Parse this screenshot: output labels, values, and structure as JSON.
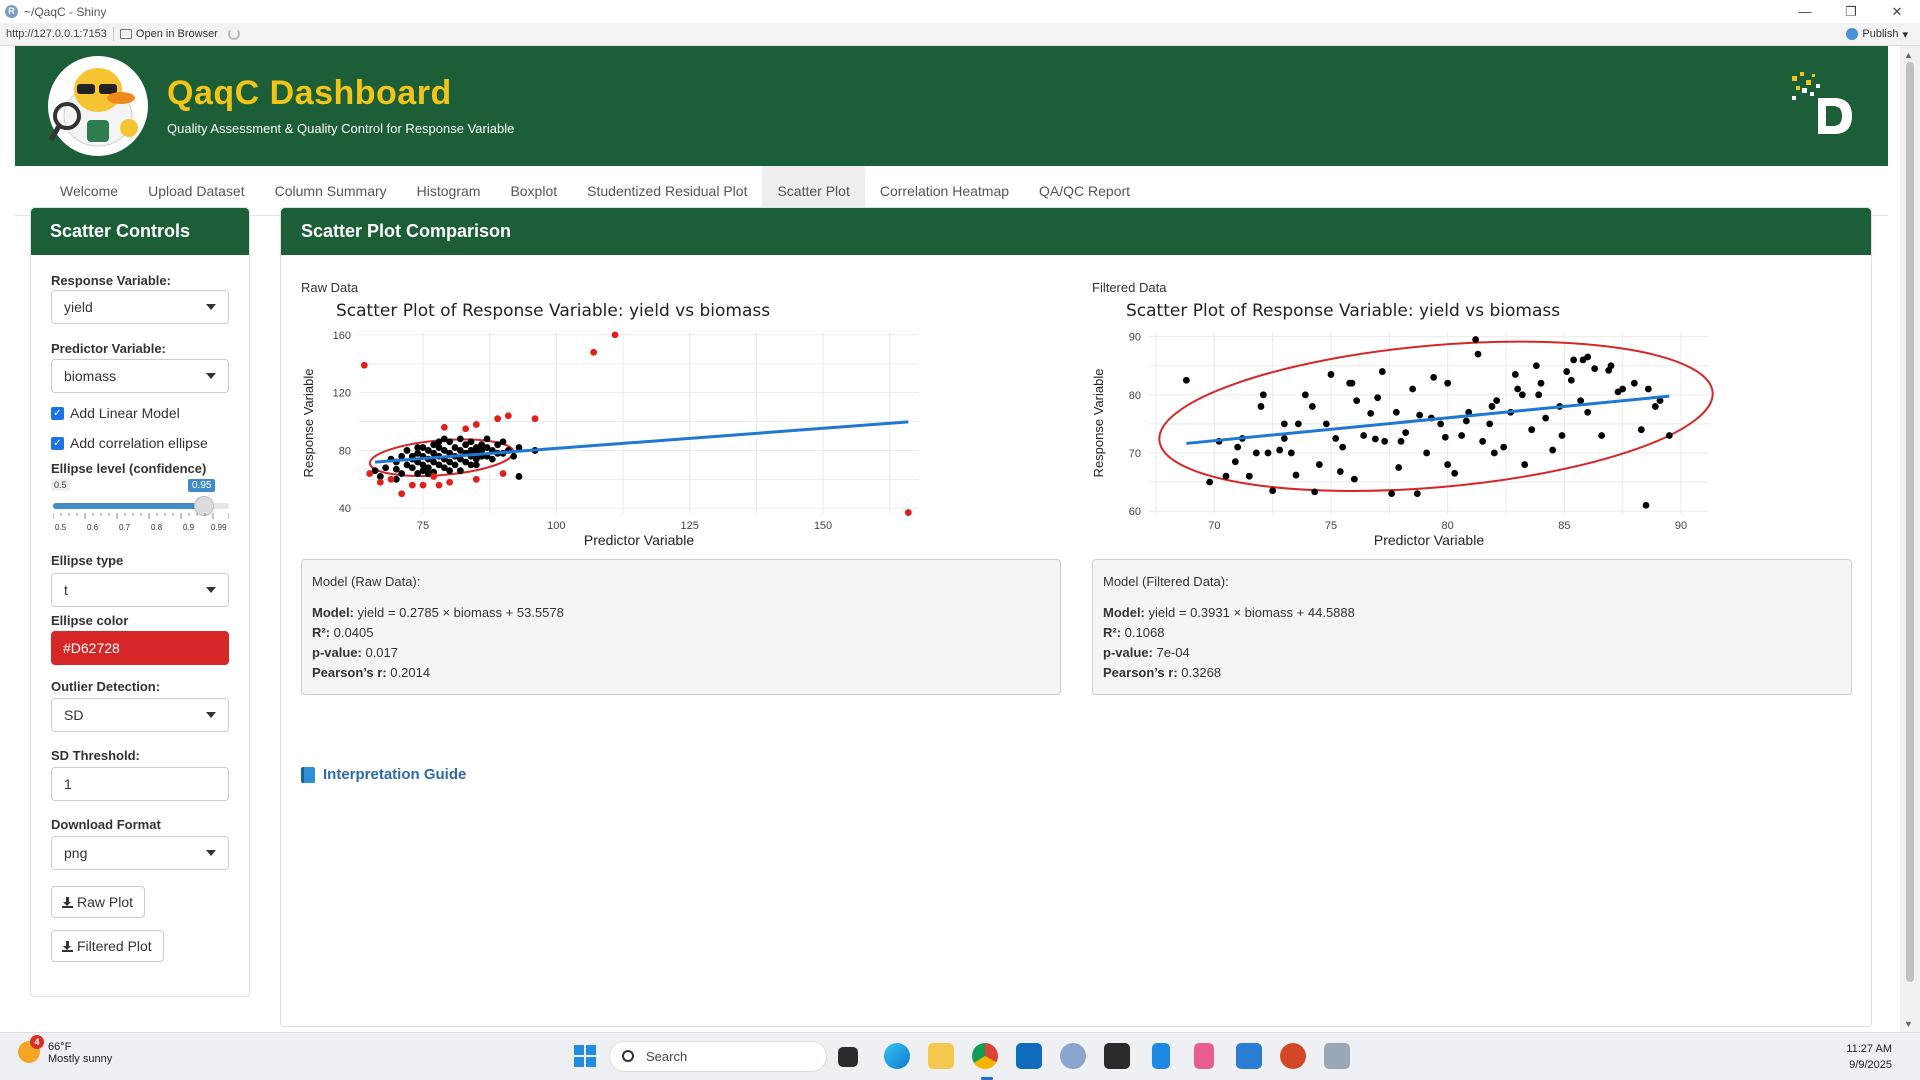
{
  "window": {
    "title": "~/QaqC - Shiny",
    "url": "http://127.0.0.1:7153",
    "open_in_browser": "Open in Browser",
    "publish": "Publish"
  },
  "header": {
    "title": "QaqC Dashboard",
    "subtitle": "Quality Assessment & Quality Control for Response Variable"
  },
  "tabs": [
    "Welcome",
    "Upload Dataset",
    "Column Summary",
    "Histogram",
    "Boxplot",
    "Studentized Residual Plot",
    "Scatter Plot",
    "Correlation Heatmap",
    "QA/QC Report"
  ],
  "active_tab": "Scatter Plot",
  "sidebar": {
    "title": "Scatter Controls",
    "response_label": "Response Variable:",
    "response_value": "yield",
    "predictor_label": "Predictor Variable:",
    "predictor_value": "biomass",
    "add_linear_model": "Add Linear Model",
    "add_corr_ellipse": "Add correlation ellipse",
    "ellipse_level_label": "Ellipse level (confidence)",
    "ellipse_level_min": "0.5",
    "ellipse_level_value": "0.95",
    "ellipse_level_ticks": [
      "0.5",
      "0.6",
      "0.7",
      "0.8",
      "0.9",
      "0.99"
    ],
    "ellipse_level_fraction": 0.92,
    "ellipse_type_label": "Ellipse type",
    "ellipse_type_value": "t",
    "ellipse_color_label": "Ellipse color",
    "ellipse_color_value": "#D62728",
    "outlier_label": "Outlier Detection:",
    "outlier_value": "SD",
    "sd_threshold_label": "SD Threshold:",
    "sd_threshold_value": "1",
    "download_format_label": "Download Format",
    "download_format_value": "png",
    "raw_plot_button": "Raw Plot",
    "filtered_plot_button": "Filtered Plot"
  },
  "main": {
    "title": "Scatter Plot Comparison",
    "raw_label": "Raw Data",
    "filtered_label": "Filtered Data",
    "raw_model": {
      "heading": "Model (Raw Data):",
      "model_key": "Model:",
      "model_val": "yield = 0.2785 × biomass + 53.5578",
      "r2_key": "R²:",
      "r2_val": "0.0405",
      "p_key": "p-value:",
      "p_val": "0.017",
      "r_key": "Pearson’s r:",
      "r_val": "0.2014"
    },
    "filtered_model": {
      "heading": "Model (Filtered Data):",
      "model_key": "Model:",
      "model_val": "yield = 0.3931 × biomass + 44.5888",
      "r2_key": "R²:",
      "r2_val": "0.1068",
      "p_key": "p-value:",
      "p_val": "7e-04",
      "r_key": "Pearson’s r:",
      "r_val": "0.3268"
    },
    "guide": "Interpretation Guide"
  },
  "chart_data": [
    {
      "type": "scatter",
      "title": "Scatter Plot of Response Variable: yield vs biomass",
      "xlabel": "Predictor Variable",
      "ylabel": "Response Variable",
      "xlim": [
        63,
        168
      ],
      "ylim": [
        36,
        162
      ],
      "xticks": [
        75,
        100,
        125,
        150
      ],
      "yticks": [
        40,
        80,
        120,
        160
      ],
      "grid": true,
      "colors": {
        "normal": "#000000",
        "outlier": "#e0201b",
        "fit": "#1f78d1",
        "ellipse": "#D62728"
      },
      "fit_line": {
        "slope": 0.2785,
        "intercept": 53.5578,
        "x_range": [
          66,
          166
        ]
      },
      "ellipse": {
        "cx": 78.5,
        "cy": 75,
        "rx_data": 13.5,
        "ry_data": 12,
        "angle_data": 0.3
      },
      "normal_points": [
        [
          66,
          66
        ],
        [
          68,
          68
        ],
        [
          69,
          74
        ],
        [
          70,
          72
        ],
        [
          70,
          67
        ],
        [
          71,
          76
        ],
        [
          72,
          70
        ],
        [
          72,
          80
        ],
        [
          73,
          74
        ],
        [
          73,
          68
        ],
        [
          74,
          78
        ],
        [
          74,
          72
        ],
        [
          74,
          64
        ],
        [
          75,
          82
        ],
        [
          75,
          76
        ],
        [
          75,
          70
        ],
        [
          75,
          66
        ],
        [
          76,
          74
        ],
        [
          76,
          80
        ],
        [
          76,
          68
        ],
        [
          77,
          72
        ],
        [
          77,
          78
        ],
        [
          77,
          65
        ],
        [
          78,
          76
        ],
        [
          78,
          70
        ],
        [
          78,
          82
        ],
        [
          79,
          74
        ],
        [
          79,
          68
        ],
        [
          79,
          80
        ],
        [
          80,
          78
        ],
        [
          80,
          72
        ],
        [
          80,
          86
        ],
        [
          81,
          76
        ],
        [
          81,
          70
        ],
        [
          81,
          82
        ],
        [
          82,
          80
        ],
        [
          82,
          74
        ],
        [
          82,
          66
        ],
        [
          83,
          84
        ],
        [
          83,
          78
        ],
        [
          83,
          72
        ],
        [
          84,
          80
        ],
        [
          84,
          76
        ],
        [
          84,
          86
        ],
        [
          85,
          82
        ],
        [
          85,
          74
        ],
        [
          85,
          78
        ],
        [
          86,
          84
        ],
        [
          86,
          80
        ],
        [
          86,
          76
        ],
        [
          87,
          88
        ],
        [
          87,
          82
        ],
        [
          88,
          80
        ],
        [
          88,
          74
        ],
        [
          89,
          84
        ],
        [
          89,
          78
        ],
        [
          90,
          86
        ],
        [
          91,
          80
        ],
        [
          92,
          76
        ],
        [
          93,
          82
        ],
        [
          93,
          62
        ],
        [
          96,
          80
        ],
        [
          70,
          60
        ],
        [
          73,
          76
        ],
        [
          76,
          64
        ],
        [
          78,
          86
        ],
        [
          80,
          66
        ],
        [
          84,
          70
        ],
        [
          87,
          76
        ],
        [
          90,
          78
        ],
        [
          67,
          62
        ],
        [
          71,
          64
        ],
        [
          74,
          82
        ],
        [
          77,
          84
        ],
        [
          79,
          88
        ],
        [
          82,
          88
        ],
        [
          85,
          70
        ]
      ],
      "outlier_points": [
        [
          64,
          139
        ],
        [
          107,
          148
        ],
        [
          111,
          160
        ],
        [
          166,
          37
        ],
        [
          79,
          96
        ],
        [
          85,
          98
        ],
        [
          89,
          102
        ],
        [
          91,
          104
        ],
        [
          96,
          102
        ],
        [
          83,
          95
        ],
        [
          67,
          58
        ],
        [
          69,
          60
        ],
        [
          73,
          56
        ],
        [
          75,
          56
        ],
        [
          78,
          56
        ],
        [
          80,
          58
        ],
        [
          85,
          60
        ],
        [
          90,
          64
        ],
        [
          71,
          50
        ],
        [
          65,
          64
        ],
        [
          77,
          62
        ]
      ]
    },
    {
      "type": "scatter",
      "title": "Scatter Plot of Response Variable: yield vs biomass",
      "xlabel": "Predictor Variable",
      "ylabel": "Response Variable",
      "xlim": [
        67.2,
        91.2
      ],
      "ylim": [
        59.5,
        90.8
      ],
      "xticks": [
        70,
        75,
        80,
        85,
        90
      ],
      "yticks": [
        60,
        70,
        80,
        90
      ],
      "grid": true,
      "colors": {
        "normal": "#000000",
        "fit": "#1f78d1",
        "ellipse": "#D62728"
      },
      "fit_line": {
        "slope": 0.3931,
        "intercept": 44.5888,
        "x_range": [
          68.8,
          89.5
        ]
      },
      "ellipse": {
        "cx": 79.5,
        "cy": 76.3,
        "rx_data": 11.9,
        "ry_data": 12.2,
        "angle_data": 0.35
      },
      "normal_points": [
        [
          68.8,
          82.5
        ],
        [
          69.8,
          65
        ],
        [
          70.2,
          72
        ],
        [
          70.9,
          68.5
        ],
        [
          71.2,
          72.5
        ],
        [
          71.5,
          66
        ],
        [
          71.8,
          70
        ],
        [
          72,
          78
        ],
        [
          72.1,
          80
        ],
        [
          72.3,
          70
        ],
        [
          72.5,
          63.5
        ],
        [
          73,
          72.5
        ],
        [
          73.3,
          70
        ],
        [
          73.6,
          75
        ],
        [
          73.9,
          80
        ],
        [
          74.2,
          78
        ],
        [
          74.5,
          68
        ],
        [
          74.8,
          75
        ],
        [
          75,
          83.5
        ],
        [
          75.2,
          72.5
        ],
        [
          75.5,
          71
        ],
        [
          75.8,
          82
        ],
        [
          76.1,
          79
        ],
        [
          76.4,
          73
        ],
        [
          76.7,
          76.8
        ],
        [
          77,
          79.5
        ],
        [
          77.3,
          72
        ],
        [
          77.6,
          63
        ],
        [
          77.9,
          67.5
        ],
        [
          78.2,
          73.5
        ],
        [
          78.5,
          81
        ],
        [
          78.8,
          76.5
        ],
        [
          79.1,
          70
        ],
        [
          79.4,
          83
        ],
        [
          79.7,
          75
        ],
        [
          80,
          82
        ],
        [
          80.3,
          66.5
        ],
        [
          80.6,
          73
        ],
        [
          80.9,
          77
        ],
        [
          81.2,
          89.5
        ],
        [
          81.5,
          72
        ],
        [
          81.8,
          75
        ],
        [
          82.1,
          79
        ],
        [
          82.4,
          71
        ],
        [
          82.7,
          77
        ],
        [
          83,
          81
        ],
        [
          83.3,
          68
        ],
        [
          83.6,
          74
        ],
        [
          83.9,
          80
        ],
        [
          84.2,
          76
        ],
        [
          84.5,
          70.5
        ],
        [
          84.8,
          78
        ],
        [
          85.1,
          84
        ],
        [
          85.4,
          86
        ],
        [
          85.7,
          79
        ],
        [
          86,
          77
        ],
        [
          86.3,
          84.5
        ],
        [
          86.6,
          73
        ],
        [
          87,
          85
        ],
        [
          87.5,
          81
        ],
        [
          88,
          82
        ],
        [
          88.3,
          74
        ],
        [
          88.6,
          81
        ],
        [
          88.9,
          78
        ],
        [
          89.1,
          79
        ],
        [
          89.5,
          73
        ],
        [
          71,
          71
        ],
        [
          73,
          75
        ],
        [
          76,
          65.5
        ],
        [
          78,
          72
        ],
        [
          80,
          68
        ],
        [
          82,
          70
        ],
        [
          84,
          82
        ],
        [
          86,
          86.5
        ],
        [
          70.5,
          66
        ],
        [
          72.8,
          70.5
        ],
        [
          74.3,
          63.3
        ],
        [
          77.2,
          84
        ],
        [
          79.3,
          76
        ],
        [
          81.3,
          87
        ],
        [
          83.2,
          80
        ],
        [
          85.3,
          82.5
        ],
        [
          87.3,
          80.5
        ],
        [
          88.5,
          61
        ],
        [
          75.4,
          66.8
        ],
        [
          76.9,
          72.4
        ],
        [
          78.7,
          63
        ],
        [
          80.8,
          75.5
        ],
        [
          82.9,
          83.5
        ],
        [
          84.9,
          73
        ],
        [
          86.9,
          84.2
        ],
        [
          73.5,
          66.2
        ],
        [
          75.9,
          82
        ],
        [
          77.8,
          77
        ],
        [
          79.9,
          72.7
        ],
        [
          81.9,
          78
        ],
        [
          83.8,
          85
        ],
        [
          85.8,
          86
        ]
      ]
    }
  ],
  "taskbar": {
    "weather_temp": "66°F",
    "weather_desc": "Mostly sunny",
    "weather_badge": "4",
    "search_placeholder": "Search",
    "time": "11:27 AM",
    "date": "9/9/2025"
  }
}
